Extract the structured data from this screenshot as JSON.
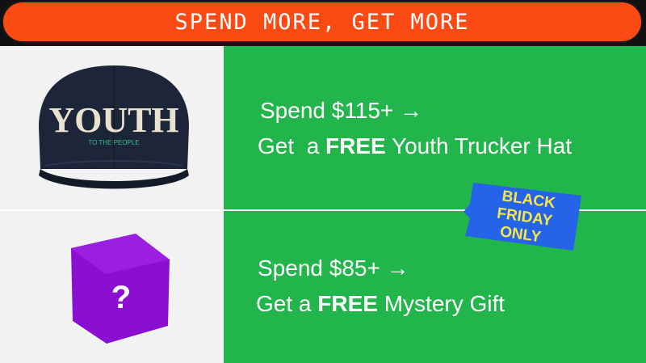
{
  "banner": {
    "text": "SPEND MORE, GET MORE"
  },
  "tiers": [
    {
      "threshold": "Spend $115+ →",
      "reward_prefix": "Get  a ",
      "reward_free": "FREE",
      "reward_suffix": " Youth Trucker Hat",
      "image": {
        "icon": "trucker-hat-icon",
        "hat_text": "YOUTH",
        "hat_subtext": "TO THE PEOPLE"
      }
    },
    {
      "threshold": "Spend $85+ →",
      "reward_prefix": "Get a ",
      "reward_free": "FREE",
      "reward_suffix": " Mystery Gift",
      "image": {
        "icon": "mystery-box-icon",
        "symbol": "?"
      }
    }
  ],
  "sticker": {
    "line1": "BLACK",
    "line2": "FRIDAY",
    "line3": "ONLY"
  },
  "colors": {
    "banner": "#fc4a15",
    "promo": "#22b54b",
    "image_bg": "#f2f2f2",
    "sticker": "#2563e8",
    "sticker_text": "#f5e64a",
    "box": "#8a0fd1",
    "hat": "#1c2638"
  }
}
